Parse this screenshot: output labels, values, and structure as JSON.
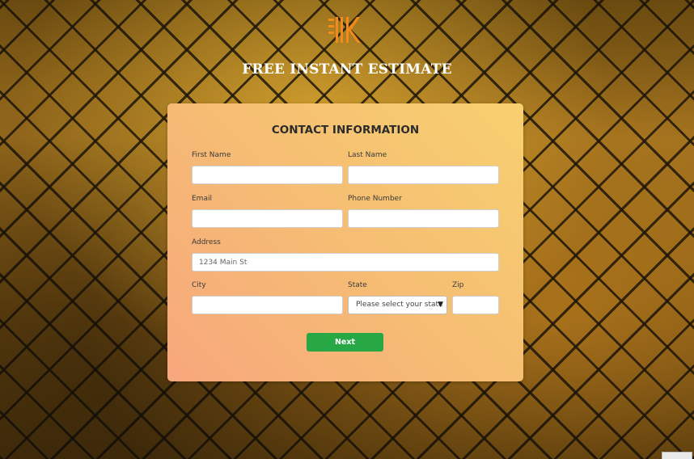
{
  "header": {
    "title": "FREE INSTANT ESTIMATE",
    "logo_icon": "brand-logo-icon",
    "logo_color": "#f28a1c"
  },
  "form": {
    "title": "CONTACT INFORMATION",
    "first_name": {
      "label": "First Name",
      "value": "",
      "placeholder": ""
    },
    "last_name": {
      "label": "Last Name",
      "value": "",
      "placeholder": ""
    },
    "email": {
      "label": "Email",
      "value": "",
      "placeholder": ""
    },
    "phone": {
      "label": "Phone Number",
      "value": "",
      "placeholder": ""
    },
    "address": {
      "label": "Address",
      "value": "",
      "placeholder": "1234 Main St"
    },
    "city": {
      "label": "City",
      "value": "",
      "placeholder": ""
    },
    "state": {
      "label": "State",
      "selected": "Please select your state"
    },
    "zip": {
      "label": "Zip",
      "value": "",
      "placeholder": ""
    },
    "next_label": "Next",
    "next_color": "#28a745"
  }
}
